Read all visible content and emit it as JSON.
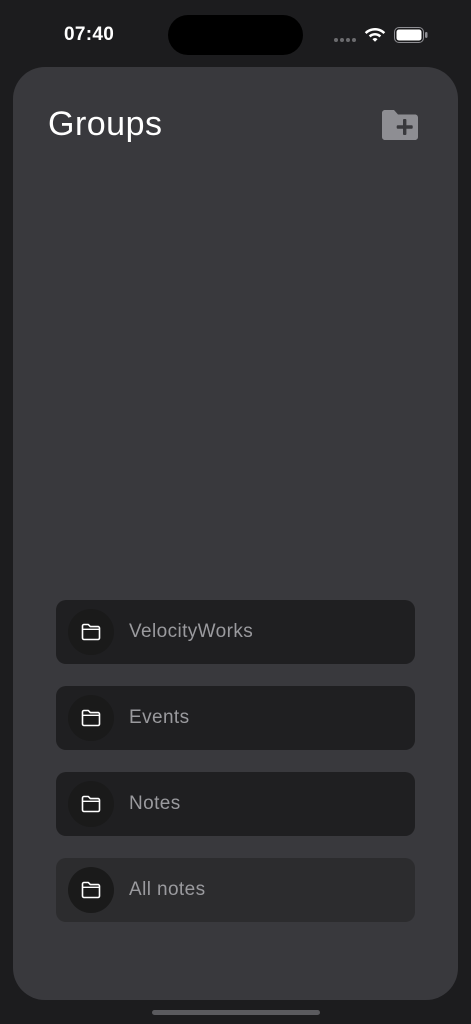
{
  "status_bar": {
    "time": "07:40"
  },
  "header": {
    "title": "Groups",
    "new_group_icon": "folder-plus-icon"
  },
  "groups": [
    {
      "label": "VelocityWorks",
      "icon": "folder-icon",
      "selected": false
    },
    {
      "label": "Events",
      "icon": "folder-icon",
      "selected": false
    },
    {
      "label": "Notes",
      "icon": "folder-icon",
      "selected": false
    },
    {
      "label": "All notes",
      "icon": "folder-icon",
      "selected": true
    }
  ],
  "colors": {
    "background": "#1c1c1e",
    "sheet": "#39393d",
    "item": "#1f1f21",
    "item_selected": "#2c2c2e",
    "label": "#9a9a9e",
    "icon_accent": "#8e8e93"
  }
}
